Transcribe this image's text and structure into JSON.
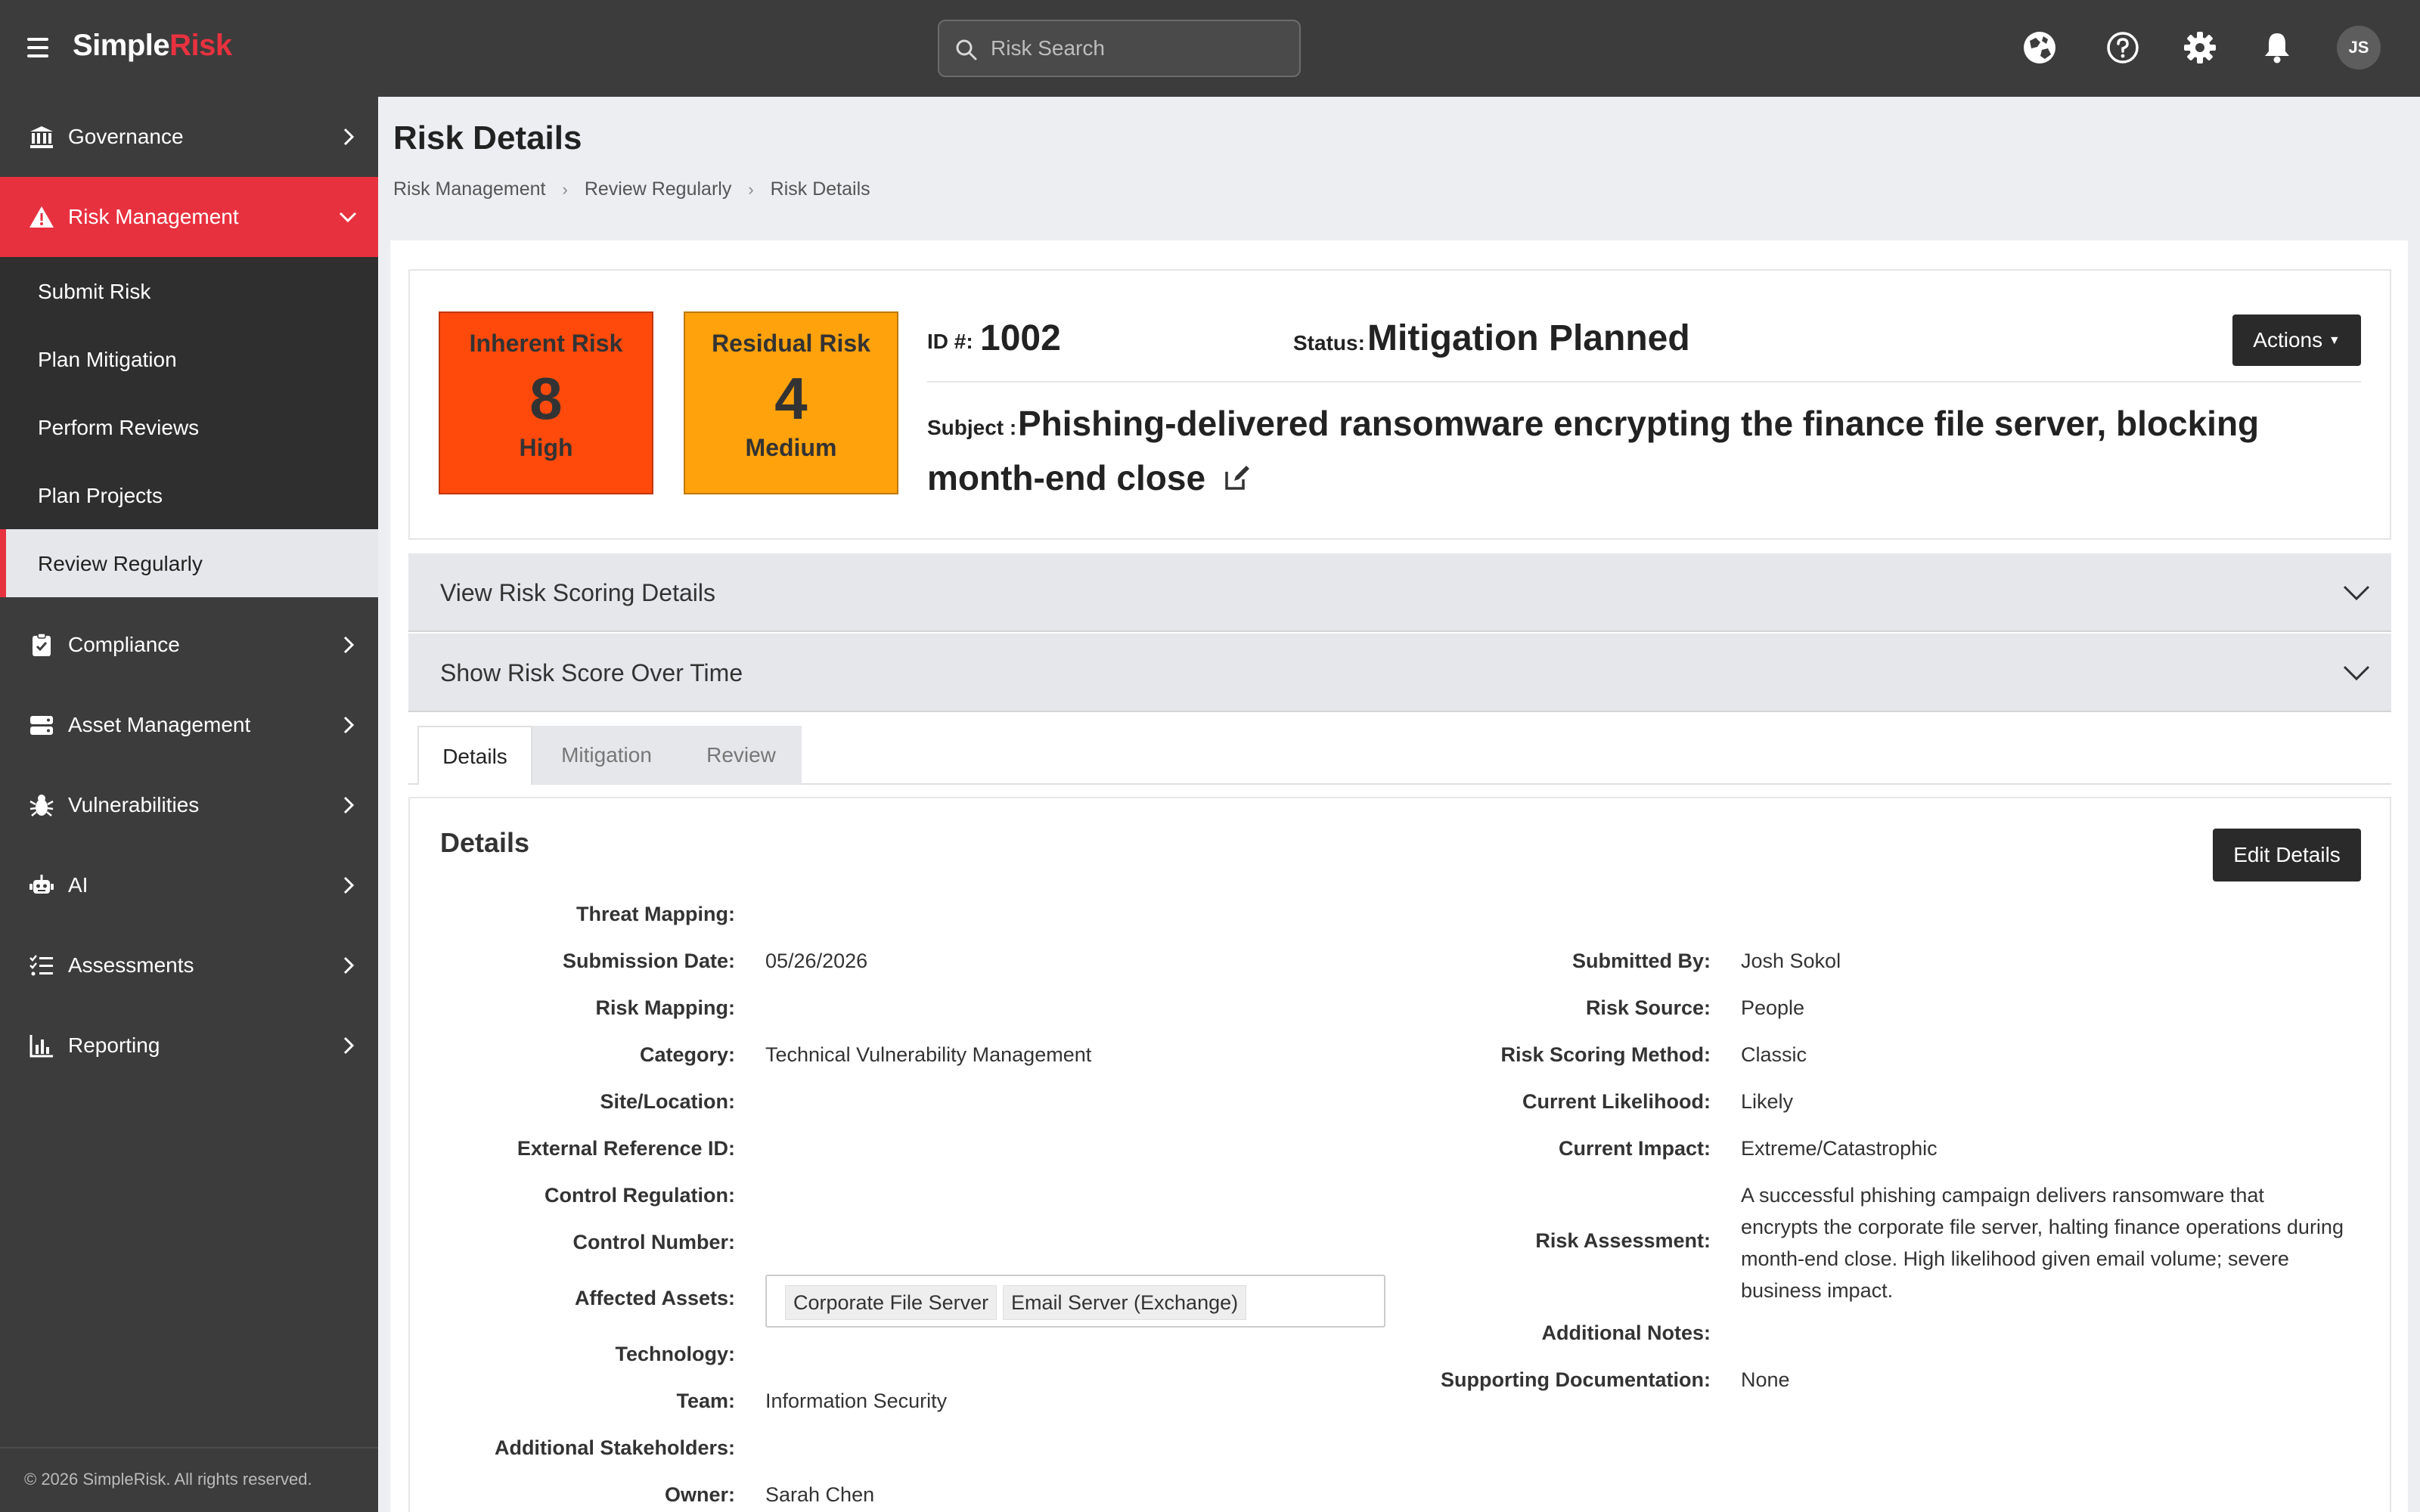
{
  "app": {
    "logo_primary": "Simple",
    "logo_accent": "Risk",
    "search_placeholder": "Risk Search",
    "user_initials": "JS",
    "brand_color": "#e8313f"
  },
  "top_icons": [
    "language-icon",
    "help-icon",
    "settings-icon",
    "notification-bell-icon"
  ],
  "sidebar": {
    "items": [
      {
        "label": "Governance",
        "icon": "bank-icon"
      },
      {
        "label": "Risk Management",
        "icon": "warning-icon",
        "active": true
      },
      {
        "label": "Compliance",
        "icon": "clipboard-check-icon"
      },
      {
        "label": "Asset Management",
        "icon": "server-icon"
      },
      {
        "label": "Vulnerabilities",
        "icon": "bug-icon"
      },
      {
        "label": "AI",
        "icon": "robot-icon"
      },
      {
        "label": "Assessments",
        "icon": "list-check-icon"
      },
      {
        "label": "Reporting",
        "icon": "bar-chart-icon"
      }
    ],
    "sub_items": [
      "Submit Risk",
      "Plan Mitigation",
      "Perform Reviews",
      "Plan Projects",
      "Review Regularly"
    ],
    "current_sub": "Review Regularly",
    "footer": "© 2026 SimpleRisk. All rights reserved."
  },
  "page": {
    "title": "Risk Details",
    "breadcrumb": [
      "Risk Management",
      "Review Regularly",
      "Risk Details"
    ]
  },
  "risk": {
    "inherent": {
      "title": "Inherent Risk",
      "score": "8",
      "level": "High",
      "color": "#ff4a0c"
    },
    "residual": {
      "title": "Residual Risk",
      "score": "4",
      "level": "Medium",
      "color": "#ffa20c"
    },
    "id_label": "ID #:",
    "id": "1002",
    "status_label": "Status:",
    "status": "Mitigation Planned",
    "actions_label": "Actions",
    "subject_label": "Subject :",
    "subject": "Phishing-delivered ransomware encrypting the finance file server, blocking month-end close"
  },
  "accordions": [
    "View Risk Scoring Details",
    "Show Risk Score Over Time"
  ],
  "tabs": [
    "Details",
    "Mitigation",
    "Review"
  ],
  "details": {
    "title": "Details",
    "edit_label": "Edit Details",
    "left": [
      {
        "label": "Threat Mapping:",
        "value": ""
      },
      {
        "label": "Submission Date:",
        "value": "05/26/2026"
      },
      {
        "label": "Risk Mapping:",
        "value": ""
      },
      {
        "label": "Category:",
        "value": "Technical Vulnerability Management"
      },
      {
        "label": "Site/Location:",
        "value": ""
      },
      {
        "label": "External Reference ID:",
        "value": ""
      },
      {
        "label": "Control Regulation:",
        "value": ""
      },
      {
        "label": "Control Number:",
        "value": ""
      },
      {
        "label": "Affected Assets:",
        "value": ""
      },
      {
        "label": "Technology:",
        "value": ""
      },
      {
        "label": "Team:",
        "value": "Information Security"
      },
      {
        "label": "Additional Stakeholders:",
        "value": ""
      },
      {
        "label": "Owner:",
        "value": "Sarah Chen"
      }
    ],
    "affected_assets": [
      "Corporate File Server",
      "Email Server (Exchange)"
    ],
    "right": [
      {
        "label": "Submitted By:",
        "value": "Josh Sokol"
      },
      {
        "label": "Risk Source:",
        "value": "People"
      },
      {
        "label": "Risk Scoring Method:",
        "value": "Classic"
      },
      {
        "label": "Current Likelihood:",
        "value": "Likely"
      },
      {
        "label": "Current Impact:",
        "value": "Extreme/Catastrophic"
      },
      {
        "label": "Risk Assessment:",
        "value": "A successful phishing campaign delivers ransomware that encrypts the corporate file server, halting finance operations during month-end close. High likelihood given email volume; severe business impact."
      },
      {
        "label": "Additional Notes:",
        "value": ""
      },
      {
        "label": "Supporting Documentation:",
        "value": "None"
      }
    ]
  }
}
